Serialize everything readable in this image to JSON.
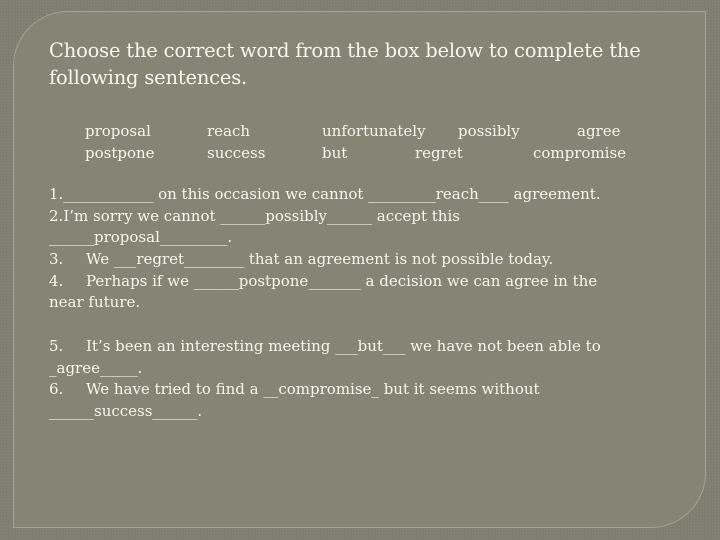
{
  "slide": {
    "title": "Choose the correct word from the box below to complete the following sentences.",
    "word_box": {
      "row1": [
        "proposal",
        "reach",
        "unfortunately",
        "possibly",
        "agree"
      ],
      "row2": [
        "postpone",
        "success",
        "but",
        "regret",
        "compromise"
      ]
    },
    "sentences": [
      {
        "number": "1.",
        "lines": [
          "____________ on this occasion we cannot _________reach____ agreement."
        ]
      },
      {
        "number": "2.",
        "lines": [
          "I’m sorry we cannot ______possibly______ accept this",
          "______proposal_________."
        ]
      },
      {
        "number": "3.",
        "lines": [
          "We ___regret________ that an agreement is not possible today."
        ]
      },
      {
        "number": "4.",
        "lines": [
          "Perhaps if we ______postpone_______ a decision we can agree in the",
          "near future."
        ]
      },
      {
        "number": "5.",
        "lines": [
          "It’s been an interesting meeting ___but___ we have not been able to",
          "_agree_____."
        ]
      },
      {
        "number": "6.",
        "lines": [
          "We have tried to find a __compromise_ but it seems without",
          "______success______."
        ]
      }
    ]
  }
}
